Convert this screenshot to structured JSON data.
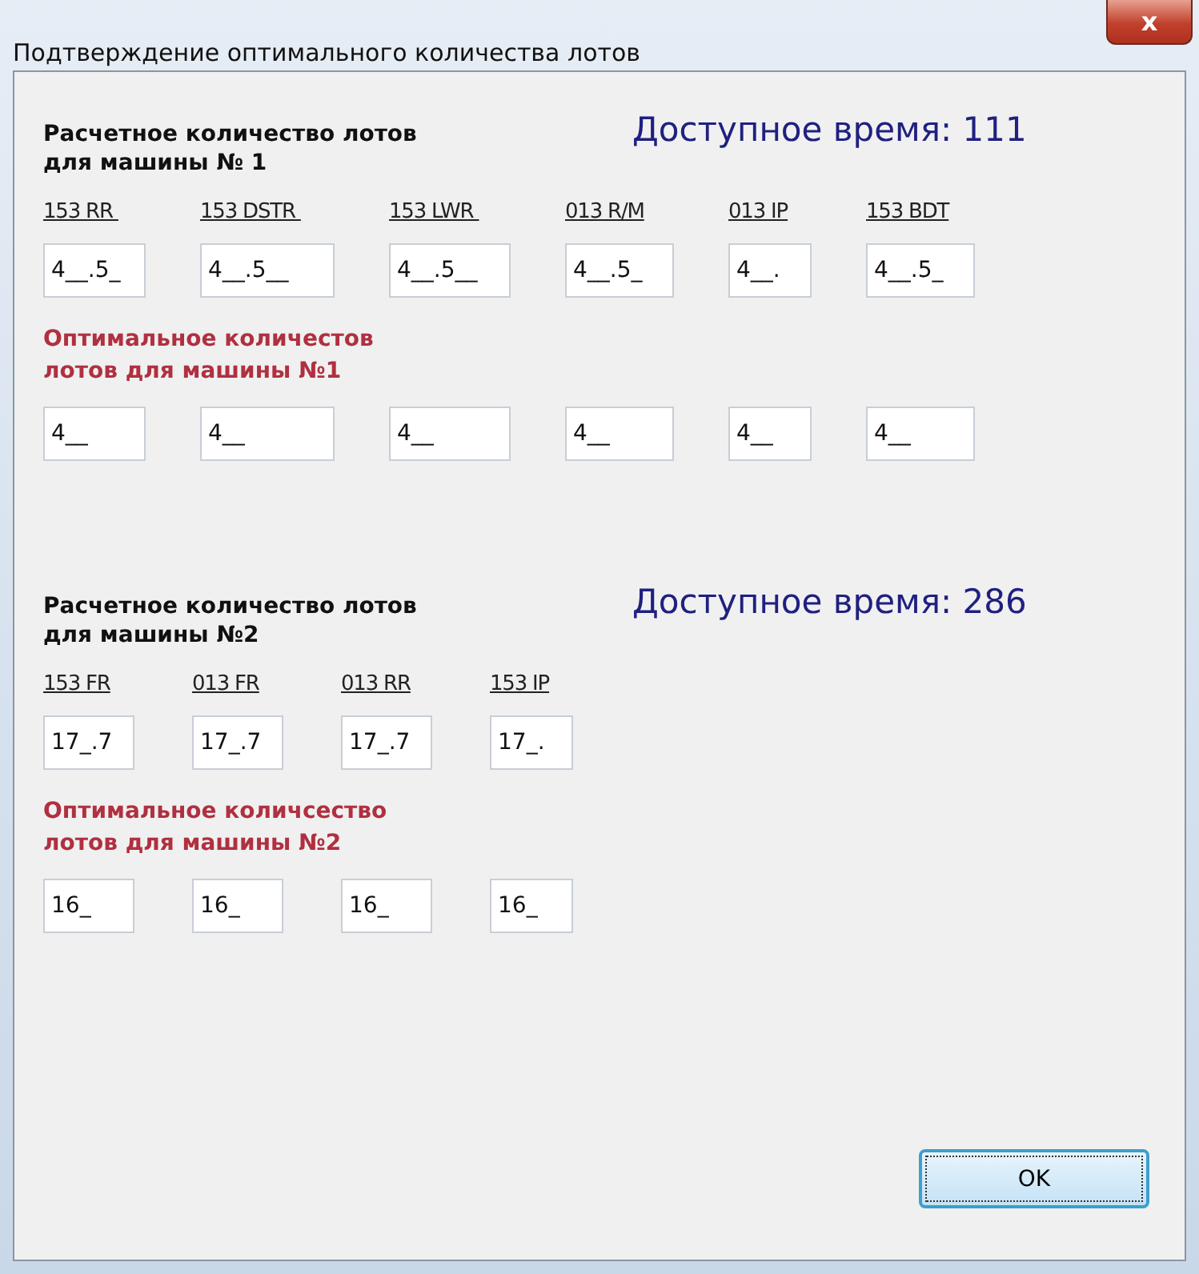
{
  "window": {
    "title": "Подтверждение оптимального количества лотов",
    "close": "x"
  },
  "sections": [
    {
      "heading": "Расчетное количество лотов\nдля машины № 1",
      "time": "Доступное время: 111",
      "columns": [
        "153 RR ",
        "153 DSTR ",
        "153 LWR ",
        "013 R/M",
        "013 IP",
        "153 BDT"
      ],
      "estimates": [
        "4__.5_",
        "4__.5__",
        "4__.5__",
        "4__.5_",
        "4__.",
        "4__.5_"
      ],
      "optimal_label": "Оптимальное количестов\nлотов для машины №1",
      "optimal": [
        "4__",
        "4__",
        "4__",
        "4__",
        "4__",
        "4__"
      ]
    },
    {
      "heading": "Расчетное количество лотов\nдля машины №2",
      "time": "Доступное время: 286",
      "columns": [
        "153 FR",
        "013 FR",
        "013 RR",
        "153 IP"
      ],
      "estimates": [
        "17_.7",
        "17_.7",
        "17_.7",
        "17_."
      ],
      "optimal_label": "Оптимальное количсество\nлотов для машины №2",
      "optimal": [
        "16_",
        "16_",
        "16_",
        "16_"
      ]
    }
  ],
  "buttons": [
    {
      "label": "OK",
      "focused": true
    }
  ]
}
